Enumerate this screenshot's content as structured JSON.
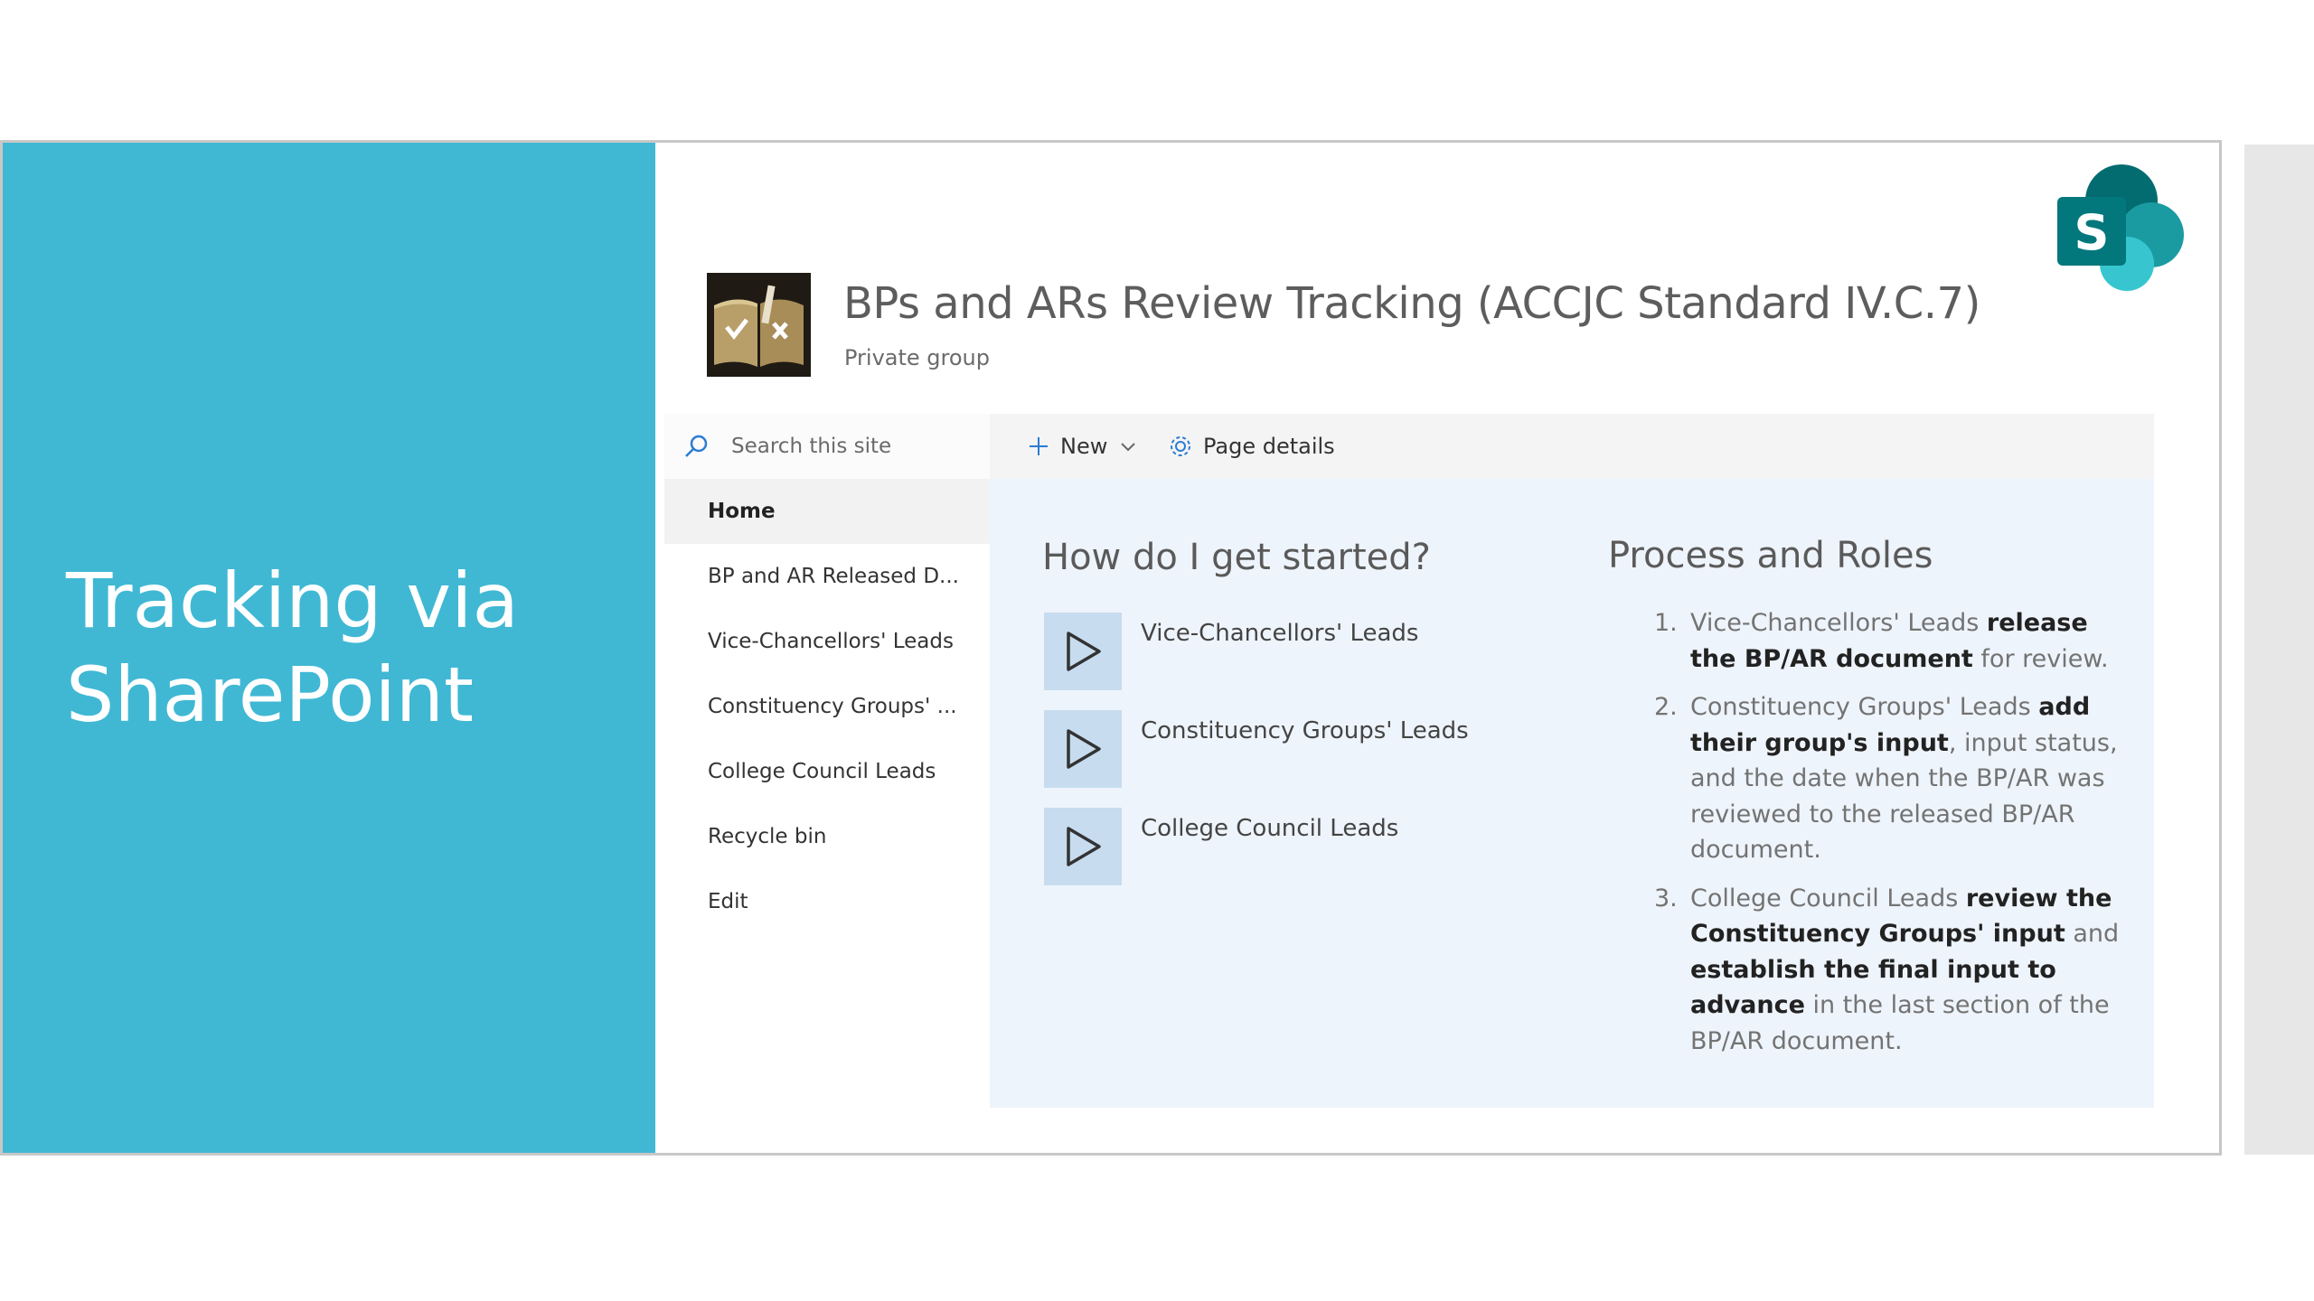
{
  "slide": {
    "title_line1": "Tracking via",
    "title_line2": "SharePoint"
  },
  "site": {
    "title": "BPs and ARs Review Tracking (ACCJC Standard IV.C.7)",
    "subtitle": "Private group"
  },
  "search": {
    "placeholder": "Search this site"
  },
  "commandbar": {
    "new_label": "New",
    "page_details_label": "Page details"
  },
  "nav": {
    "items": [
      {
        "label": "Home",
        "active": true
      },
      {
        "label": "BP and AR Released D..."
      },
      {
        "label": "Vice-Chancellors' Leads"
      },
      {
        "label": "Constituency Groups' ..."
      },
      {
        "label": "College Council Leads"
      },
      {
        "label": "Recycle bin"
      },
      {
        "label": "Edit"
      }
    ]
  },
  "get_started": {
    "heading": "How do I get started?",
    "links": [
      {
        "label": "Vice-Chancellors' Leads"
      },
      {
        "label": "Constituency Groups' Leads"
      },
      {
        "label": "College Council Leads"
      }
    ]
  },
  "process": {
    "heading": "Process and Roles",
    "steps": [
      {
        "num": "1.",
        "t1": "Vice-Chancellors' Leads ",
        "b1": "release the BP/AR document",
        "t2": " for review."
      },
      {
        "num": "2.",
        "t1": "Constituency Groups' Leads ",
        "b1": "add their group's input",
        "t2": ", input status, and the date when the BP/AR was reviewed to the released BP/AR document."
      },
      {
        "num": "3.",
        "t1": "College Council Leads ",
        "b1": "review the Constituency Groups' input",
        "t2": " and ",
        "b2": "establish the final input to advance",
        "t3": " in the last section of the BP/AR document."
      }
    ]
  },
  "colors": {
    "panel": "#40b8d4",
    "content_bg": "#eef4fb",
    "tile": "#c7dcef",
    "sharepoint_teal": "#036c70"
  },
  "icons": [
    "search-icon",
    "plus-icon",
    "chevron-down-icon",
    "gear-icon",
    "play-icon",
    "sharepoint-logo",
    "site-logo-book"
  ]
}
